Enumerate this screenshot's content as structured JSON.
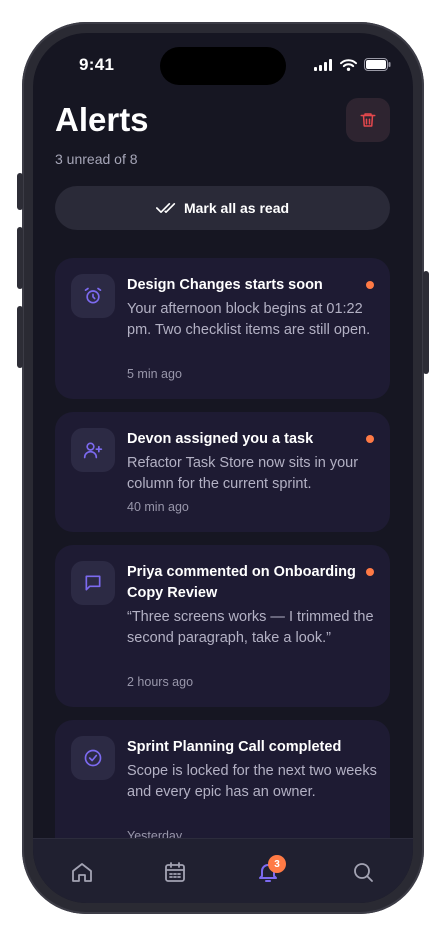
{
  "status_bar": {
    "time": "9:41"
  },
  "header": {
    "title": "Alerts",
    "subtitle": "3 unread of 8"
  },
  "actions": {
    "mark_all_label": "Mark all as read"
  },
  "notifications": [
    {
      "icon": "alarm-clock-icon",
      "title": "Design Changes starts soon",
      "body": "Your afternoon block begins at 01:22 pm. Two checklist items are still open.",
      "time": "5 min ago",
      "unread": true
    },
    {
      "icon": "user-plus-icon",
      "title": "Devon assigned you a task",
      "body": "Refactor Task Store now sits in your column for the current sprint.",
      "time": "40 min ago",
      "unread": true
    },
    {
      "icon": "message-icon",
      "title": "Priya commented on Onboarding Copy Review",
      "body": "“Three screens works — I trimmed the second paragraph, take a look.”",
      "time": "2 hours ago",
      "unread": true
    },
    {
      "icon": "check-circle-icon",
      "title": "Sprint Planning Call completed",
      "body": "Scope is locked for the next two weeks and every epic has an owner.",
      "time": "Yesterday",
      "unread": false
    }
  ],
  "tab_bar": {
    "tabs": [
      "home-icon",
      "calendar-icon",
      "bell-icon",
      "search-icon"
    ],
    "active": "bell-icon",
    "bell_badge": "3"
  },
  "colors": {
    "background": "#161622",
    "card": "#1e1b33",
    "accent": "#7c6af0",
    "unread_dot": "#ff7a45",
    "danger": "#e5484d"
  }
}
